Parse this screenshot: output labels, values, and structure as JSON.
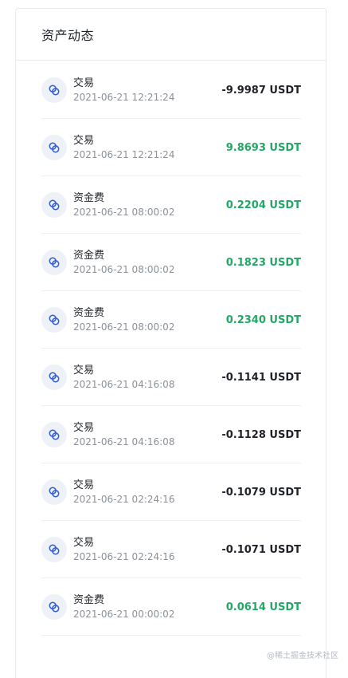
{
  "panel": {
    "title": "资产动态"
  },
  "records": [
    {
      "type": "交易",
      "time": "2021-06-21 12:21:24",
      "amount": "-9.9987 USDT",
      "sign": "neg",
      "icon": "exchange-icon"
    },
    {
      "type": "交易",
      "time": "2021-06-21 12:21:24",
      "amount": "9.8693 USDT",
      "sign": "pos",
      "icon": "exchange-icon"
    },
    {
      "type": "资金费",
      "time": "2021-06-21 08:00:02",
      "amount": "0.2204 USDT",
      "sign": "pos",
      "icon": "exchange-icon"
    },
    {
      "type": "资金费",
      "time": "2021-06-21 08:00:02",
      "amount": "0.1823 USDT",
      "sign": "pos",
      "icon": "exchange-icon"
    },
    {
      "type": "资金费",
      "time": "2021-06-21 08:00:02",
      "amount": "0.2340 USDT",
      "sign": "pos",
      "icon": "exchange-icon"
    },
    {
      "type": "交易",
      "time": "2021-06-21 04:16:08",
      "amount": "-0.1141 USDT",
      "sign": "neg",
      "icon": "exchange-icon"
    },
    {
      "type": "交易",
      "time": "2021-06-21 04:16:08",
      "amount": "-0.1128 USDT",
      "sign": "neg",
      "icon": "exchange-icon"
    },
    {
      "type": "交易",
      "time": "2021-06-21 02:24:16",
      "amount": "-0.1079 USDT",
      "sign": "neg",
      "icon": "exchange-icon"
    },
    {
      "type": "交易",
      "time": "2021-06-21 02:24:16",
      "amount": "-0.1071 USDT",
      "sign": "neg",
      "icon": "exchange-icon"
    },
    {
      "type": "资金费",
      "time": "2021-06-21 00:00:02",
      "amount": "0.0614 USDT",
      "sign": "pos",
      "icon": "exchange-icon"
    }
  ],
  "colors": {
    "positive": "#22a866",
    "negative": "#1f2329",
    "icon_accent": "#2f5bd6"
  },
  "watermark": "@稀土掘金技术社区"
}
